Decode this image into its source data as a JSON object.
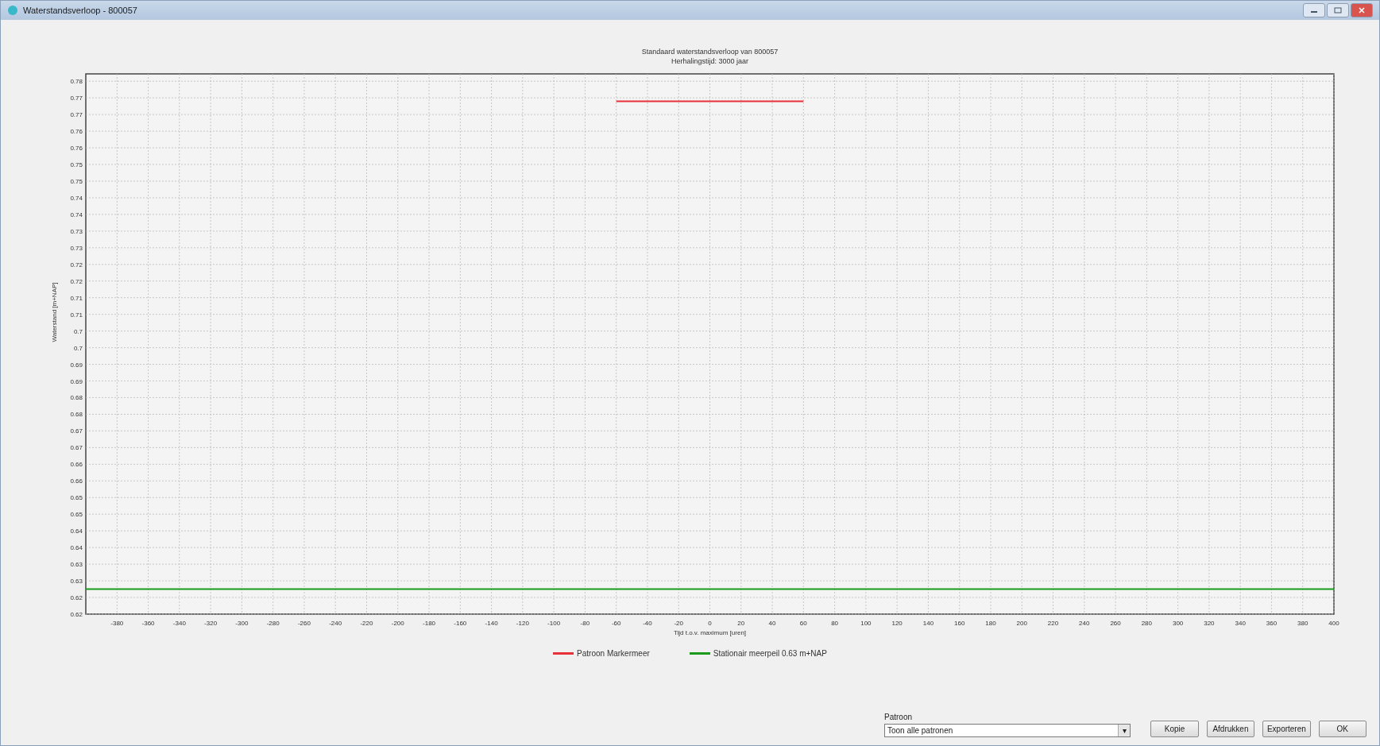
{
  "window": {
    "title": "Waterstandsverloop - 800057"
  },
  "chart": {
    "chart_data": {
      "type": "line",
      "title": "Standaard waterstandsverloop van 800057\nHerhalingstijd: 3000 jaar",
      "xlabel": "Tijd t.o.v. maximum [uren]",
      "ylabel": "Waterstand [m+NAP]",
      "xlim": [
        -400,
        400
      ],
      "ylim": [
        0.62,
        0.7822
      ],
      "grid": true,
      "xticks": [
        -380,
        -360,
        -340,
        -320,
        -300,
        -280,
        -260,
        -240,
        -220,
        -200,
        -180,
        -160,
        -140,
        -120,
        -100,
        -80,
        -60,
        -40,
        -20,
        0,
        20,
        40,
        60,
        80,
        100,
        120,
        140,
        160,
        180,
        200,
        220,
        240,
        260,
        280,
        300,
        320,
        340,
        360,
        380,
        400
      ],
      "yticks": [
        {
          "value": 0.78,
          "label": "0.78"
        },
        {
          "value": 0.775,
          "label": "0.77"
        },
        {
          "value": 0.77,
          "label": "0.77"
        },
        {
          "value": 0.765,
          "label": "0.76"
        },
        {
          "value": 0.76,
          "label": "0.76"
        },
        {
          "value": 0.755,
          "label": "0.75"
        },
        {
          "value": 0.75,
          "label": "0.75"
        },
        {
          "value": 0.745,
          "label": "0.74"
        },
        {
          "value": 0.74,
          "label": "0.74"
        },
        {
          "value": 0.735,
          "label": "0.73"
        },
        {
          "value": 0.73,
          "label": "0.73"
        },
        {
          "value": 0.725,
          "label": "0.72"
        },
        {
          "value": 0.72,
          "label": "0.72"
        },
        {
          "value": 0.715,
          "label": "0.71"
        },
        {
          "value": 0.71,
          "label": "0.71"
        },
        {
          "value": 0.705,
          "label": "0.7"
        },
        {
          "value": 0.7,
          "label": "0.7"
        },
        {
          "value": 0.695,
          "label": "0.69"
        },
        {
          "value": 0.69,
          "label": "0.69"
        },
        {
          "value": 0.685,
          "label": "0.68"
        },
        {
          "value": 0.68,
          "label": "0.68"
        },
        {
          "value": 0.675,
          "label": "0.67"
        },
        {
          "value": 0.67,
          "label": "0.67"
        },
        {
          "value": 0.665,
          "label": "0.66"
        },
        {
          "value": 0.66,
          "label": "0.66"
        },
        {
          "value": 0.655,
          "label": "0.65"
        },
        {
          "value": 0.65,
          "label": "0.65"
        },
        {
          "value": 0.645,
          "label": "0.64"
        },
        {
          "value": 0.64,
          "label": "0.64"
        },
        {
          "value": 0.635,
          "label": "0.63"
        },
        {
          "value": 0.63,
          "label": "0.63"
        },
        {
          "value": 0.625,
          "label": "0.62"
        },
        {
          "value": 0.62,
          "label": "0.62"
        }
      ],
      "series": [
        {
          "name": "Patroon Markermeer",
          "color": "#e8303a",
          "x": [
            -60,
            60
          ],
          "values": [
            0.774,
            0.774
          ]
        },
        {
          "name": "Stationair meerpeil 0.63 m+NAP",
          "color": "#1a9a1a",
          "x": [
            -400,
            400
          ],
          "values": [
            0.6275,
            0.6275
          ]
        }
      ]
    }
  },
  "controls": {
    "pattern_label": "Patroon",
    "pattern_value": "Toon alle patronen",
    "dropdown_arrow": "▾",
    "buttons": [
      "Kopie",
      "Afdrukken",
      "Exporteren",
      "OK"
    ]
  }
}
